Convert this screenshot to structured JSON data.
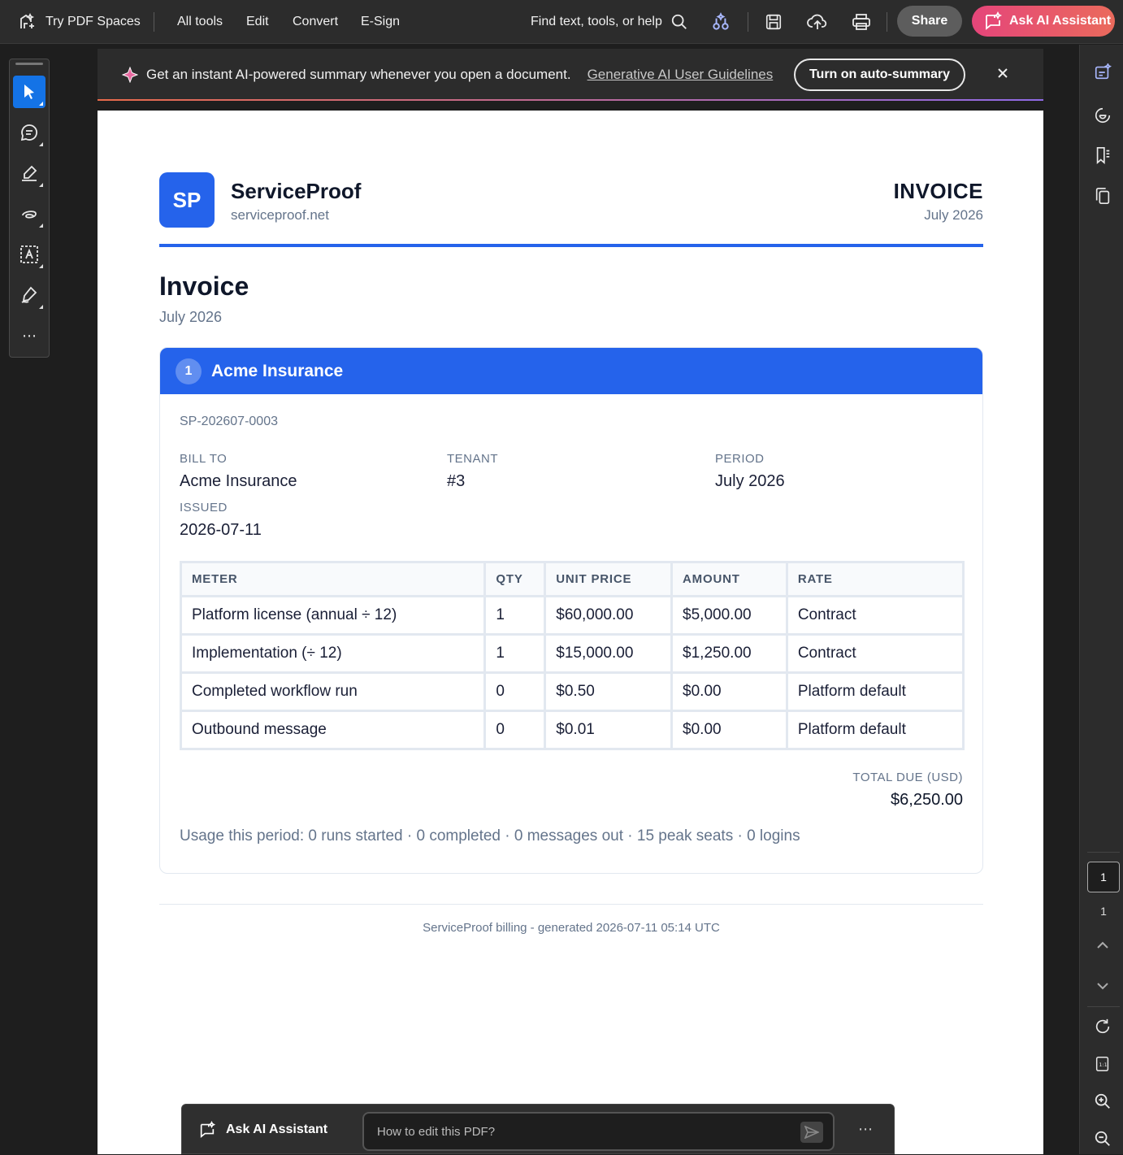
{
  "toolbar": {
    "try_spaces": "Try PDF Spaces",
    "nav": [
      "All tools",
      "Edit",
      "Convert",
      "E-Sign"
    ],
    "search_label": "Find text, tools, or help",
    "share": "Share",
    "ask_ai": "Ask AI Assistant"
  },
  "banner": {
    "message": "Get an instant AI-powered summary whenever you open a document.",
    "link": "Generative AI User Guidelines",
    "button": "Turn on auto-summary"
  },
  "pager": {
    "current": "1",
    "total": "1"
  },
  "doc": {
    "logo": "SP",
    "brand": "ServiceProof",
    "brand_url": "serviceproof.net",
    "header_title": "INVOICE",
    "header_period": "July 2026",
    "title": "Invoice",
    "subtitle": "July 2026",
    "card": {
      "number": "1",
      "customer": "Acme Insurance",
      "invoice_no": "SP-202607-0003",
      "fields": {
        "bill_to_label": "BILL TO",
        "bill_to": "Acme Insurance",
        "tenant_label": "TENANT",
        "tenant": "#3",
        "period_label": "PERIOD",
        "period": "July 2026",
        "issued_label": "ISSUED",
        "issued": "2026-07-11"
      },
      "table": {
        "headers": [
          "METER",
          "QTY",
          "UNIT PRICE",
          "AMOUNT",
          "RATE"
        ],
        "rows": [
          [
            "Platform license (annual ÷ 12)",
            "1",
            "$60,000.00",
            "$5,000.00",
            "Contract"
          ],
          [
            "Implementation (÷ 12)",
            "1",
            "$15,000.00",
            "$1,250.00",
            "Contract"
          ],
          [
            "Completed workflow run",
            "0",
            "$0.50",
            "$0.00",
            "Platform default"
          ],
          [
            "Outbound message",
            "0",
            "$0.01",
            "$0.00",
            "Platform default"
          ]
        ]
      },
      "total_label": "TOTAL DUE (USD)",
      "total": "$6,250.00",
      "usage": "Usage this period: 0 runs started · 0 completed · 0 messages out · 15 peak seats · 0 logins"
    },
    "footer": "ServiceProof billing - generated 2026-07-11 05:14 UTC"
  },
  "ai_bar": {
    "title": "Ask AI Assistant",
    "placeholder": "How to edit this PDF?"
  }
}
